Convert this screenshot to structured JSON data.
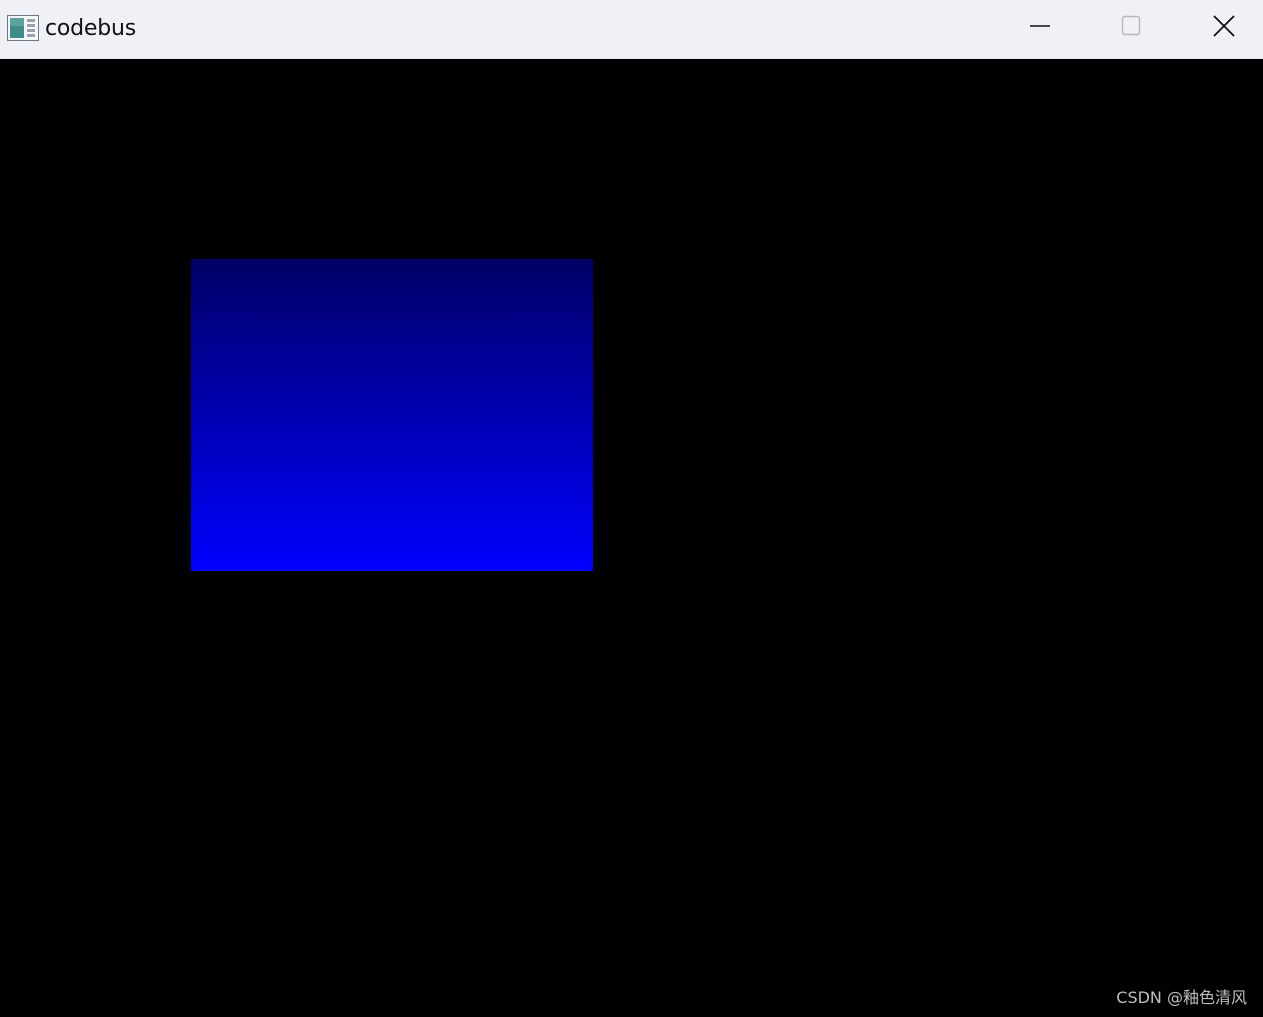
{
  "window": {
    "title": "codebus",
    "app_icon": "app-window-icon",
    "controls": {
      "minimize_icon": "minimize-icon",
      "maximize_icon": "maximize-icon",
      "close_icon": "close-icon"
    }
  },
  "canvas": {
    "background_color": "#000000",
    "shape": {
      "kind": "rectangle",
      "gradient_top_color": "#000066",
      "gradient_bottom_color": "#0000ff"
    }
  },
  "watermark": {
    "text": "CSDN @釉色清风"
  }
}
